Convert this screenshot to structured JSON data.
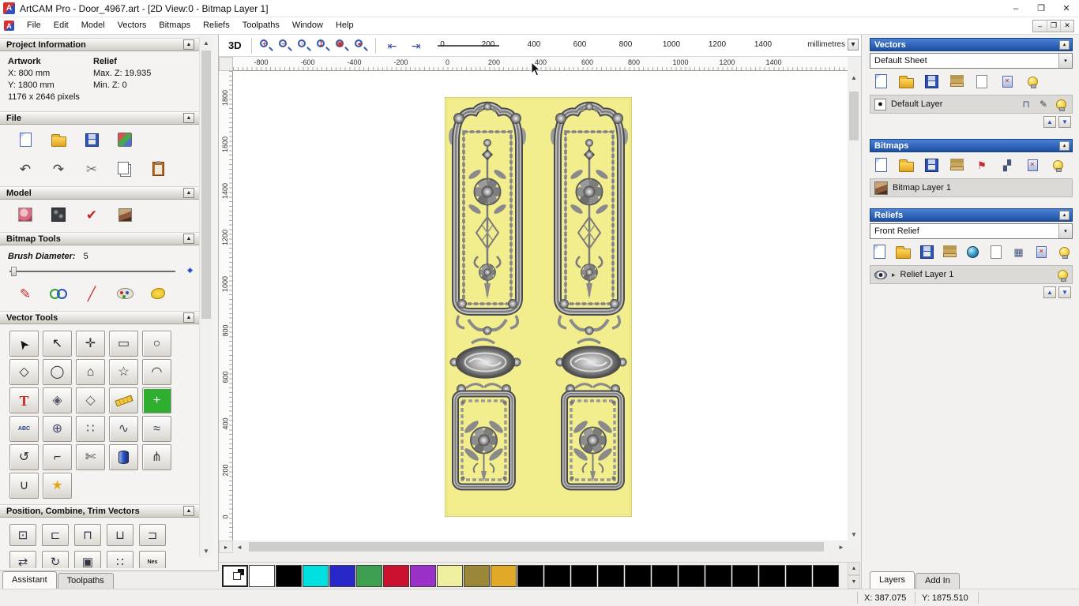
{
  "titlebar": {
    "app_initial": "A",
    "title": "ArtCAM Pro - Door_4967.art - [2D View:0 - Bitmap Layer 1]",
    "minimize": "–",
    "maximize": "❐",
    "close": "✕"
  },
  "menubar": {
    "items": [
      {
        "name": "menu-file",
        "label": "File"
      },
      {
        "name": "menu-edit",
        "label": "Edit"
      },
      {
        "name": "menu-model",
        "label": "Model"
      },
      {
        "name": "menu-vectors",
        "label": "Vectors"
      },
      {
        "name": "menu-bitmaps",
        "label": "Bitmaps"
      },
      {
        "name": "menu-reliefs",
        "label": "Reliefs"
      },
      {
        "name": "menu-toolpaths",
        "label": "Toolpaths"
      },
      {
        "name": "menu-window",
        "label": "Window"
      },
      {
        "name": "menu-help",
        "label": "Help"
      }
    ],
    "mdi_minimize": "–",
    "mdi_restore": "❐",
    "mdi_close": "✕"
  },
  "toolbar2d": {
    "view3d_label": "3D",
    "zoom_tools": [
      {
        "name": "zoom-in-icon",
        "overlay": "+"
      },
      {
        "name": "zoom-out-icon",
        "overlay": "−"
      },
      {
        "name": "zoom-window-icon",
        "overlay": "▫"
      },
      {
        "name": "zoom-1to1-icon",
        "overlay": "1"
      },
      {
        "name": "zoom-fit-icon",
        "overlay": "▣"
      },
      {
        "name": "zoom-previous-icon",
        "overlay": "◂"
      }
    ],
    "nav_tools": [
      {
        "name": "pan-left-icon",
        "glyph": "⇤",
        "color": "#33509e"
      },
      {
        "name": "pan-right-icon",
        "glyph": "⇥",
        "color": "#33509e"
      }
    ],
    "scale_ticks": [
      "0",
      "200",
      "400",
      "600",
      "800",
      "1000",
      "1200",
      "1400"
    ],
    "units_label": "millimetres",
    "units_dropdown_glyph": "▾"
  },
  "rulers": {
    "top": [
      "-800",
      "-600",
      "-400",
      "-200",
      "0",
      "200",
      "400",
      "600",
      "800",
      "1000",
      "1200",
      "1400"
    ],
    "left": [
      "1800",
      "1600",
      "1400",
      "1200",
      "1000",
      "800",
      "600",
      "400",
      "200",
      "0"
    ]
  },
  "assistant": {
    "collapse_glyph": "▲",
    "project_information": {
      "title": "Project Information",
      "artwork_label": "Artwork",
      "artwork_x": "X: 800 mm",
      "artwork_y": "Y: 1800 mm",
      "artwork_pixels": "1176 x 2646 pixels",
      "relief_label": "Relief",
      "relief_max_z": "Max. Z: 19.935",
      "relief_min_z": "Min. Z: 0"
    },
    "file_section": {
      "title": "File",
      "row1": [
        {
          "name": "new-model-icon",
          "cls": "ic-page"
        },
        {
          "name": "open-model-icon",
          "cls": "ic-folder"
        },
        {
          "name": "save-model-icon",
          "cls": "ic-save"
        },
        {
          "name": "import-export-icon",
          "cls": "ic-import"
        }
      ],
      "row2": [
        {
          "name": "undo-icon",
          "glyph": "↶",
          "color": "#3a3a3a"
        },
        {
          "name": "redo-icon",
          "glyph": "↷",
          "color": "#3a3a3a"
        },
        {
          "name": "cut-icon",
          "glyph": "✂",
          "color": "#777777"
        },
        {
          "name": "copy-icon",
          "cls": "ic-copy"
        },
        {
          "name": "paste-icon",
          "cls": "ic-paste"
        }
      ]
    },
    "model_section": {
      "title": "Model",
      "icons": [
        {
          "name": "load-clipart-icon",
          "cls": "ic-clipart"
        },
        {
          "name": "relief-texture-icon",
          "cls": "ic-texture"
        },
        {
          "name": "sculpting-icon",
          "glyph": "✔",
          "color": "#c42828"
        },
        {
          "name": "face-photo-icon",
          "cls": "ic-lena"
        }
      ]
    },
    "bitmap_tools": {
      "title": "Bitmap Tools",
      "brush_label": "Brush Diameter:",
      "brush_value": "5",
      "icons": [
        {
          "name": "paint-pencil-icon",
          "glyph": "✎",
          "color": "#c43030"
        },
        {
          "name": "colour-link-icon",
          "cls": "ic-2circ"
        },
        {
          "name": "paint-stroke-icon",
          "glyph": "╱",
          "color": "#c43030"
        },
        {
          "name": "palette-icon",
          "cls": "ic-palette"
        },
        {
          "name": "flood-fill-icon",
          "cls": "ic-flood"
        }
      ]
    },
    "vector_tools": {
      "title": "Vector Tools",
      "buttons": [
        {
          "name": "select-vectors-tool",
          "glyph": "➤",
          "color": "#111111",
          "cls": "rot-nw"
        },
        {
          "name": "node-editing-tool",
          "glyph": "↖",
          "color": "#222222"
        },
        {
          "name": "transform-vectors-tool",
          "glyph": "✛",
          "color": "#333333"
        },
        {
          "name": "create-rectangle-tool",
          "glyph": "▭",
          "color": "#333333"
        },
        {
          "name": "create-ellipse-tool",
          "glyph": "○",
          "color": "#333333"
        },
        {
          "name": "create-freeform-tool",
          "glyph": "◇",
          "color": "#333333"
        },
        {
          "name": "create-circle-tool",
          "glyph": "◯",
          "color": "#333333"
        },
        {
          "name": "create-polygon-tool",
          "glyph": "⌂",
          "color": "#333333"
        },
        {
          "name": "create-star-tool",
          "glyph": "☆",
          "color": "#333333"
        },
        {
          "name": "create-arc-tool",
          "glyph": "◠",
          "color": "#333333"
        },
        {
          "name": "create-text-tool",
          "glyph": "T",
          "color": "#c42828",
          "cls": "serifT"
        },
        {
          "name": "wrap-text-tool",
          "glyph": "◈",
          "color": "#555566"
        },
        {
          "name": "offset-vectors-tool",
          "glyph": "◇",
          "color": "#555566"
        },
        {
          "name": "measure-tool",
          "cls": "ic-ruler"
        },
        {
          "name": "snap-grid-tool",
          "glyph": "+",
          "color": "#ffffff",
          "bg": "#2fae2f"
        },
        {
          "name": "text-block-tool",
          "glyph": "ABC",
          "color": "#224488",
          "cls": "tinyT"
        },
        {
          "name": "wrap-sphere-tool",
          "glyph": "⊕",
          "color": "#444466"
        },
        {
          "name": "block-copy-tool",
          "glyph": "∷",
          "color": "#444466"
        },
        {
          "name": "copy-along-curve-tool",
          "glyph": "∿",
          "color": "#444466"
        },
        {
          "name": "curve-fit-tool",
          "glyph": "≈",
          "color": "#444466"
        },
        {
          "name": "spiral-tool",
          "glyph": "↺",
          "color": "#333333"
        },
        {
          "name": "fillet-tool",
          "glyph": "⌐",
          "color": "#333333"
        },
        {
          "name": "trim-vectors-tool",
          "glyph": "✄",
          "color": "#444444"
        },
        {
          "name": "extrude-tool",
          "cls": "ic-extrude"
        },
        {
          "name": "vector-doctor-tool",
          "glyph": "⋔",
          "color": "#444444"
        },
        {
          "name": "join-vectors-tool",
          "glyph": "∪",
          "color": "#333333"
        },
        {
          "name": "star-wizard-tool",
          "glyph": "★",
          "color": "#e0a818"
        }
      ]
    },
    "position_section": {
      "title": "Position, Combine, Trim Vectors",
      "buttons": [
        {
          "name": "centre-in-page-icon",
          "glyph": "⊡"
        },
        {
          "name": "align-left-icon",
          "glyph": "⊏"
        },
        {
          "name": "align-top-icon",
          "glyph": "⊓"
        },
        {
          "name": "align-bottom-icon",
          "glyph": "⊔"
        },
        {
          "name": "align-right-icon",
          "glyph": "⊐"
        },
        {
          "name": "mirror-vectors-icon",
          "glyph": "⇄"
        },
        {
          "name": "rotate-vectors-icon",
          "glyph": "↻"
        },
        {
          "name": "group-vectors-icon",
          "glyph": "▣"
        },
        {
          "name": "space-vectors-icon",
          "glyph": "∷"
        },
        {
          "name": "nesting-icon",
          "glyph": "Nes",
          "cls": "tinyT",
          "color": "#222222"
        }
      ]
    },
    "tabs": [
      {
        "name": "tab-assistant",
        "label": "Assistant",
        "activeCls": "active"
      },
      {
        "name": "tab-toolpaths",
        "label": "Toolpaths"
      }
    ]
  },
  "layers_panel": {
    "collapse_glyph": "▴",
    "dropdown_glyph": "▾",
    "move_up_glyph": "▲",
    "move_down_glyph": "▼",
    "vectors": {
      "title": "Vectors",
      "sheet_value": "Default Sheet",
      "icons": [
        {
          "name": "new-vector-layer-icon",
          "cls": "ic-page"
        },
        {
          "name": "open-vector-layer-icon",
          "cls": "ic-folder"
        },
        {
          "name": "save-vector-layer-icon",
          "cls": "ic-save"
        },
        {
          "name": "merge-vector-layers-icon",
          "cls": "ic-stack"
        },
        {
          "name": "new-sheet-icon",
          "cls": "ic-page2"
        },
        {
          "name": "delete-vector-layer-icon",
          "cls": "ic-del"
        },
        {
          "name": "all-layers-visibility-icon",
          "cls": "ic-bulb"
        }
      ],
      "layer": {
        "swatch_glyph": "●",
        "label": "Default Layer",
        "icons": [
          {
            "name": "layer-lock-icon",
            "glyph": "⊓",
            "color": "#445577"
          },
          {
            "name": "layer-edit-icon",
            "glyph": "✎",
            "color": "#444444"
          },
          {
            "name": "layer-visibility-icon",
            "cls": "ic-bulb"
          }
        ]
      }
    },
    "bitmaps": {
      "title": "Bitmaps",
      "icons": [
        {
          "name": "new-bitmap-layer-icon",
          "cls": "ic-page"
        },
        {
          "name": "open-bitmap-layer-icon",
          "cls": "ic-folder"
        },
        {
          "name": "save-bitmap-layer-icon",
          "cls": "ic-save"
        },
        {
          "name": "merge-bitmap-layers-icon",
          "cls": "ic-stack"
        },
        {
          "name": "bitmap-flag-icon",
          "glyph": "⚑",
          "color": "#c42828"
        },
        {
          "name": "bitmap-pattern-icon",
          "glyph": "▞",
          "color": "#445577"
        },
        {
          "name": "delete-bitmap-layer-icon",
          "cls": "ic-del"
        },
        {
          "name": "bitmap-visibility-icon",
          "cls": "ic-bulb"
        }
      ],
      "layer": {
        "label": "Bitmap Layer 1"
      }
    },
    "reliefs": {
      "title": "Reliefs",
      "relief_value": "Front Relief",
      "icons": [
        {
          "name": "new-relief-layer-icon",
          "cls": "ic-page"
        },
        {
          "name": "open-relief-layer-icon",
          "cls": "ic-folder"
        },
        {
          "name": "save-relief-layer-icon",
          "cls": "ic-save"
        },
        {
          "name": "merge-relief-layers-icon",
          "cls": "ic-stack"
        },
        {
          "name": "smooth-relief-icon",
          "cls": "ic-sphere"
        },
        {
          "name": "relief-sheet-icon",
          "cls": "ic-page2"
        },
        {
          "name": "relief-grid-icon",
          "glyph": "▦",
          "color": "#445577"
        },
        {
          "name": "delete-relief-layer-icon",
          "cls": "ic-del"
        },
        {
          "name": "relief-visibility-icon",
          "cls": "ic-bulb"
        }
      ],
      "layer": {
        "caret": "▸",
        "label": "Relief Layer 1"
      }
    },
    "tabs": [
      {
        "name": "tab-layers",
        "label": "Layers",
        "activeCls": "active"
      },
      {
        "name": "tab-add-in",
        "label": "Add In"
      }
    ]
  },
  "palette": {
    "selected": "#ffffff",
    "colors": [
      "#ffffff",
      "#000000",
      "#00e0e0",
      "#2828c8",
      "#3ca050",
      "#cc1030",
      "#9a30c8",
      "#efefa0",
      "#9a8838",
      "#e0aa28",
      "#000000",
      "#000000",
      "#000000",
      "#000000",
      "#000000",
      "#000000",
      "#000000",
      "#000000",
      "#000000",
      "#000000",
      "#000000",
      "#000000"
    ]
  },
  "statusbar": {
    "x_value": "X: 387.075",
    "y_value": "Y: 1875.510"
  },
  "scrollbars": {
    "up": "▲",
    "down": "▼",
    "left": "◄",
    "right": "►",
    "corner": "▸"
  }
}
